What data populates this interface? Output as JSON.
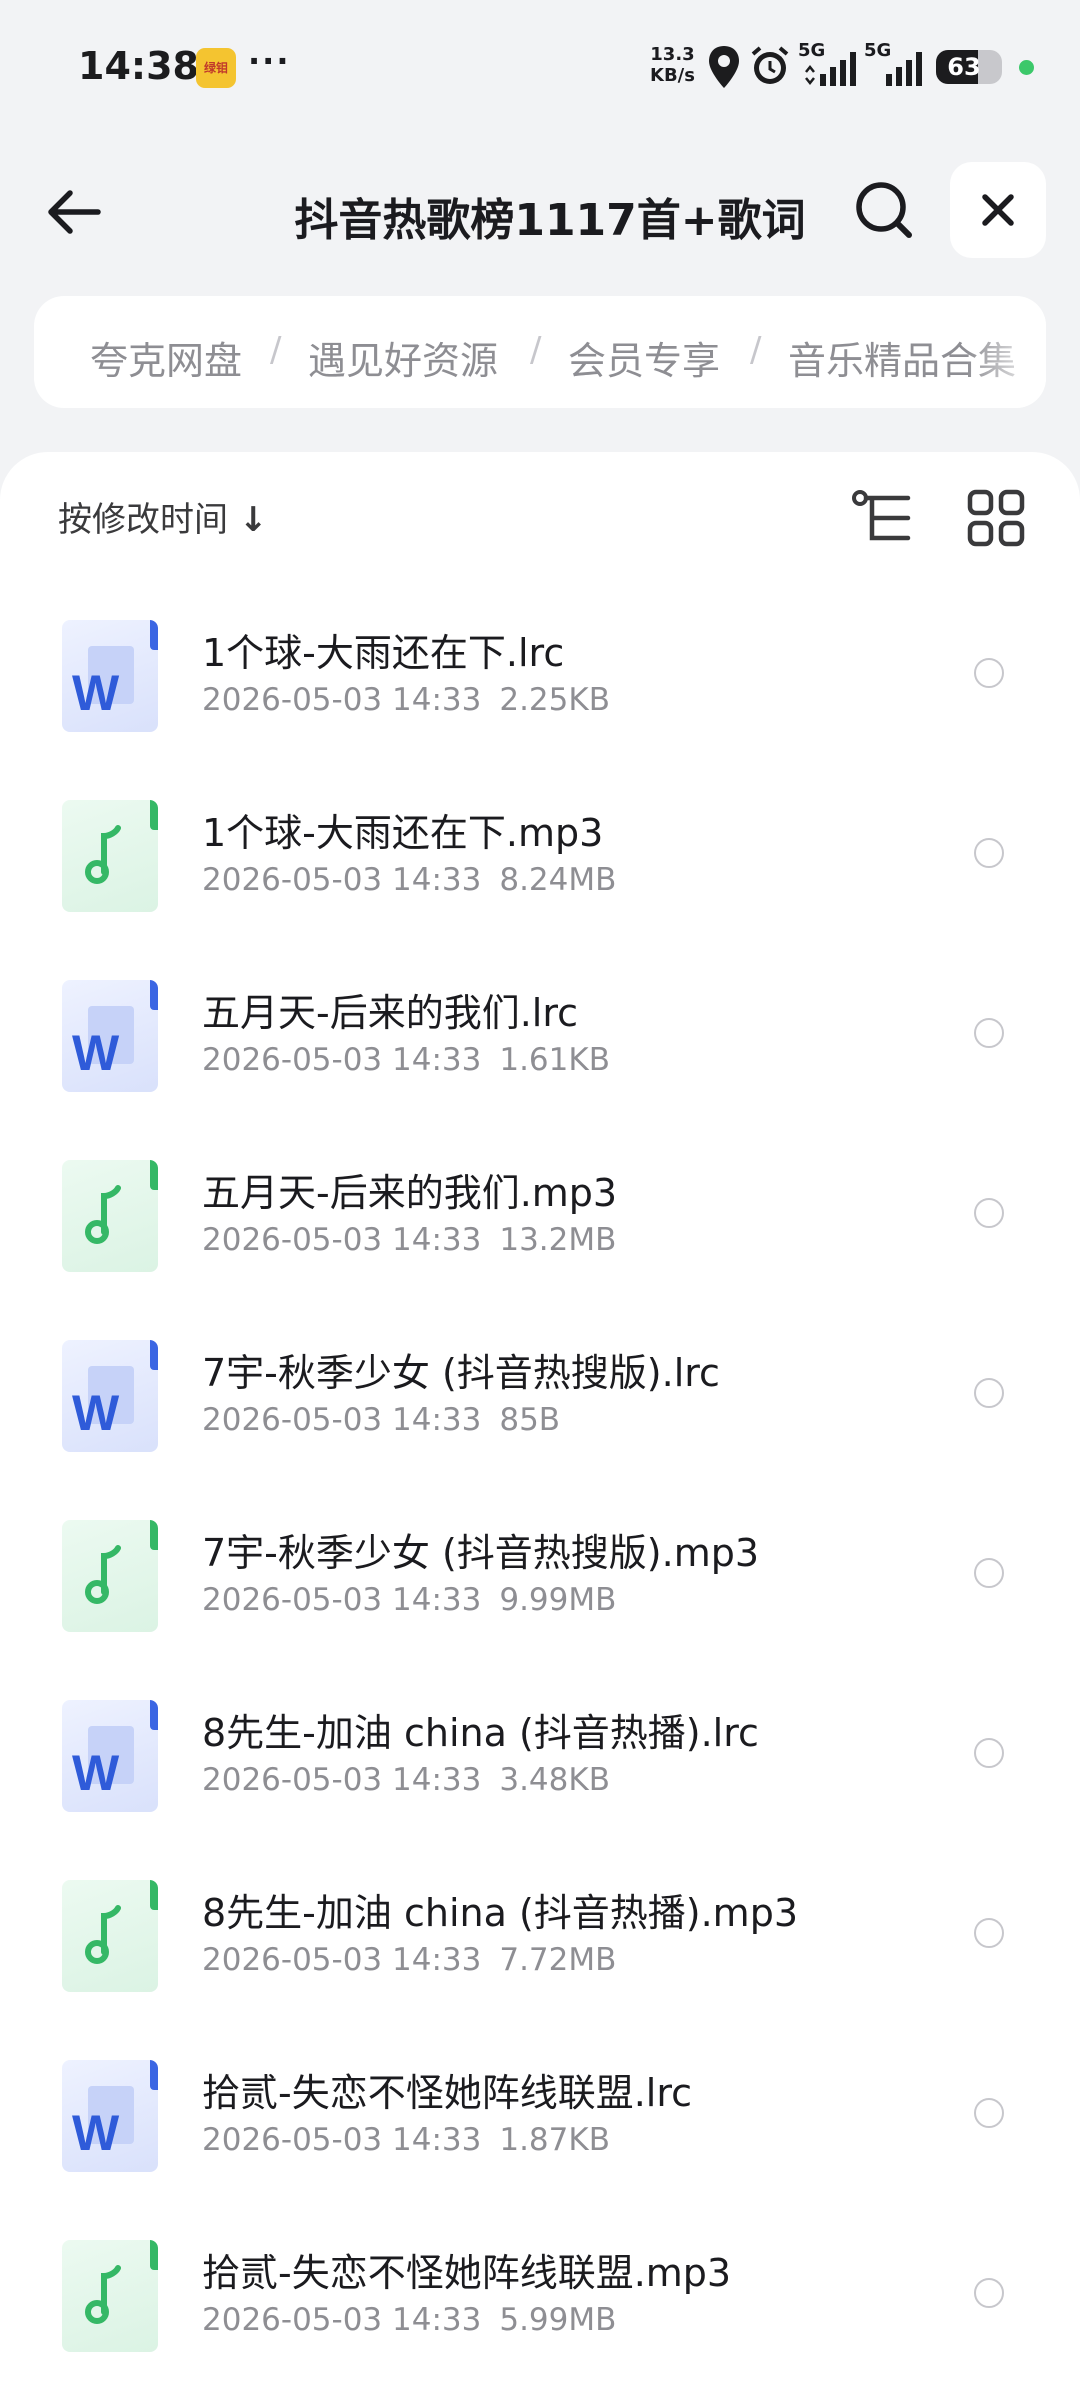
{
  "status_bar": {
    "time": "14:38",
    "notification_app_label": "绿钼",
    "more": "···",
    "net_speed_value": "13.3",
    "net_speed_unit": "KB/s",
    "signal1_label": "5G",
    "signal2_label": "5G",
    "battery_level": "63",
    "battery_fraction": 0.63,
    "charging_dot_color": "#3cc86a"
  },
  "header": {
    "title": "抖音热歌榜1117首+歌词"
  },
  "breadcrumb": {
    "items": [
      "夸克网盘",
      "遇见好资源",
      "会员专享",
      "音乐精品合集"
    ],
    "separator": "/"
  },
  "toolbar": {
    "sort_label": "按修改时间",
    "sort_arrow": "↓"
  },
  "files": [
    {
      "name": "1个球-大雨还在下.lrc",
      "date": "2026-05-03 14:33",
      "size": "2.25KB",
      "type": "doc"
    },
    {
      "name": "1个球-大雨还在下.mp3",
      "date": "2026-05-03 14:33",
      "size": "8.24MB",
      "type": "music"
    },
    {
      "name": "五月天-后来的我们.lrc",
      "date": "2026-05-03 14:33",
      "size": "1.61KB",
      "type": "doc"
    },
    {
      "name": "五月天-后来的我们.mp3",
      "date": "2026-05-03 14:33",
      "size": "13.2MB",
      "type": "music"
    },
    {
      "name": "7宇-秋季少女 (抖音热搜版).lrc",
      "date": "2026-05-03 14:33",
      "size": "85B",
      "type": "doc"
    },
    {
      "name": "7宇-秋季少女 (抖音热搜版).mp3",
      "date": "2026-05-03 14:33",
      "size": "9.99MB",
      "type": "music"
    },
    {
      "name": "8先生-加油 china (抖音热播).lrc",
      "date": "2026-05-03 14:33",
      "size": "3.48KB",
      "type": "doc"
    },
    {
      "name": "8先生-加油 china (抖音热播).mp3",
      "date": "2026-05-03 14:33",
      "size": "7.72MB",
      "type": "music"
    },
    {
      "name": "拾贰-失恋不怪她阵线联盟.lrc",
      "date": "2026-05-03 14:33",
      "size": "1.87KB",
      "type": "doc"
    },
    {
      "name": "拾贰-失恋不怪她阵线联盟.mp3",
      "date": "2026-05-03 14:33",
      "size": "5.99MB",
      "type": "music"
    }
  ],
  "icons": {
    "back": "arrow-left-icon",
    "search": "search-icon",
    "close": "close-icon",
    "tree_view": "tree-view-icon",
    "grid_view": "grid-view-icon",
    "doc_file": "word-doc-icon",
    "music_file": "music-note-icon"
  },
  "colors": {
    "doc_accent": "#2f5bd9",
    "music_accent": "#35b866"
  }
}
